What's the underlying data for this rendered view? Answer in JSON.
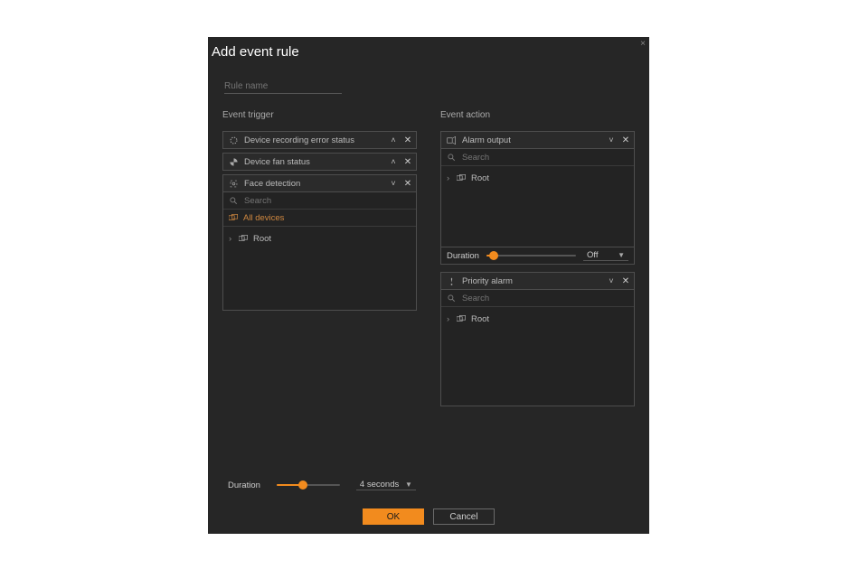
{
  "dialog": {
    "title": "Add event rule",
    "close": "×",
    "rule_name_placeholder": "Rule name"
  },
  "trigger": {
    "header": "Event trigger",
    "items": [
      {
        "label": "Device recording error status",
        "expanded": false
      },
      {
        "label": "Device fan status",
        "expanded": false
      },
      {
        "label": "Face detection",
        "expanded": true
      }
    ],
    "search_placeholder": "Search",
    "all_devices": "All devices",
    "tree_root": "Root"
  },
  "action": {
    "header": "Event action",
    "item1": {
      "label": "Alarm output"
    },
    "search_placeholder": "Search",
    "tree_root": "Root",
    "duration_label": "Duration",
    "duration_value": "Off",
    "item2": {
      "label": "Priority alarm"
    }
  },
  "footer": {
    "duration_label": "Duration",
    "duration_value": "4 seconds",
    "ok": "OK",
    "cancel": "Cancel"
  },
  "glyph": {
    "caret_up": "˄",
    "caret_down": "˅",
    "x": "✕",
    "expand": "›",
    "dropdown": "▼"
  }
}
